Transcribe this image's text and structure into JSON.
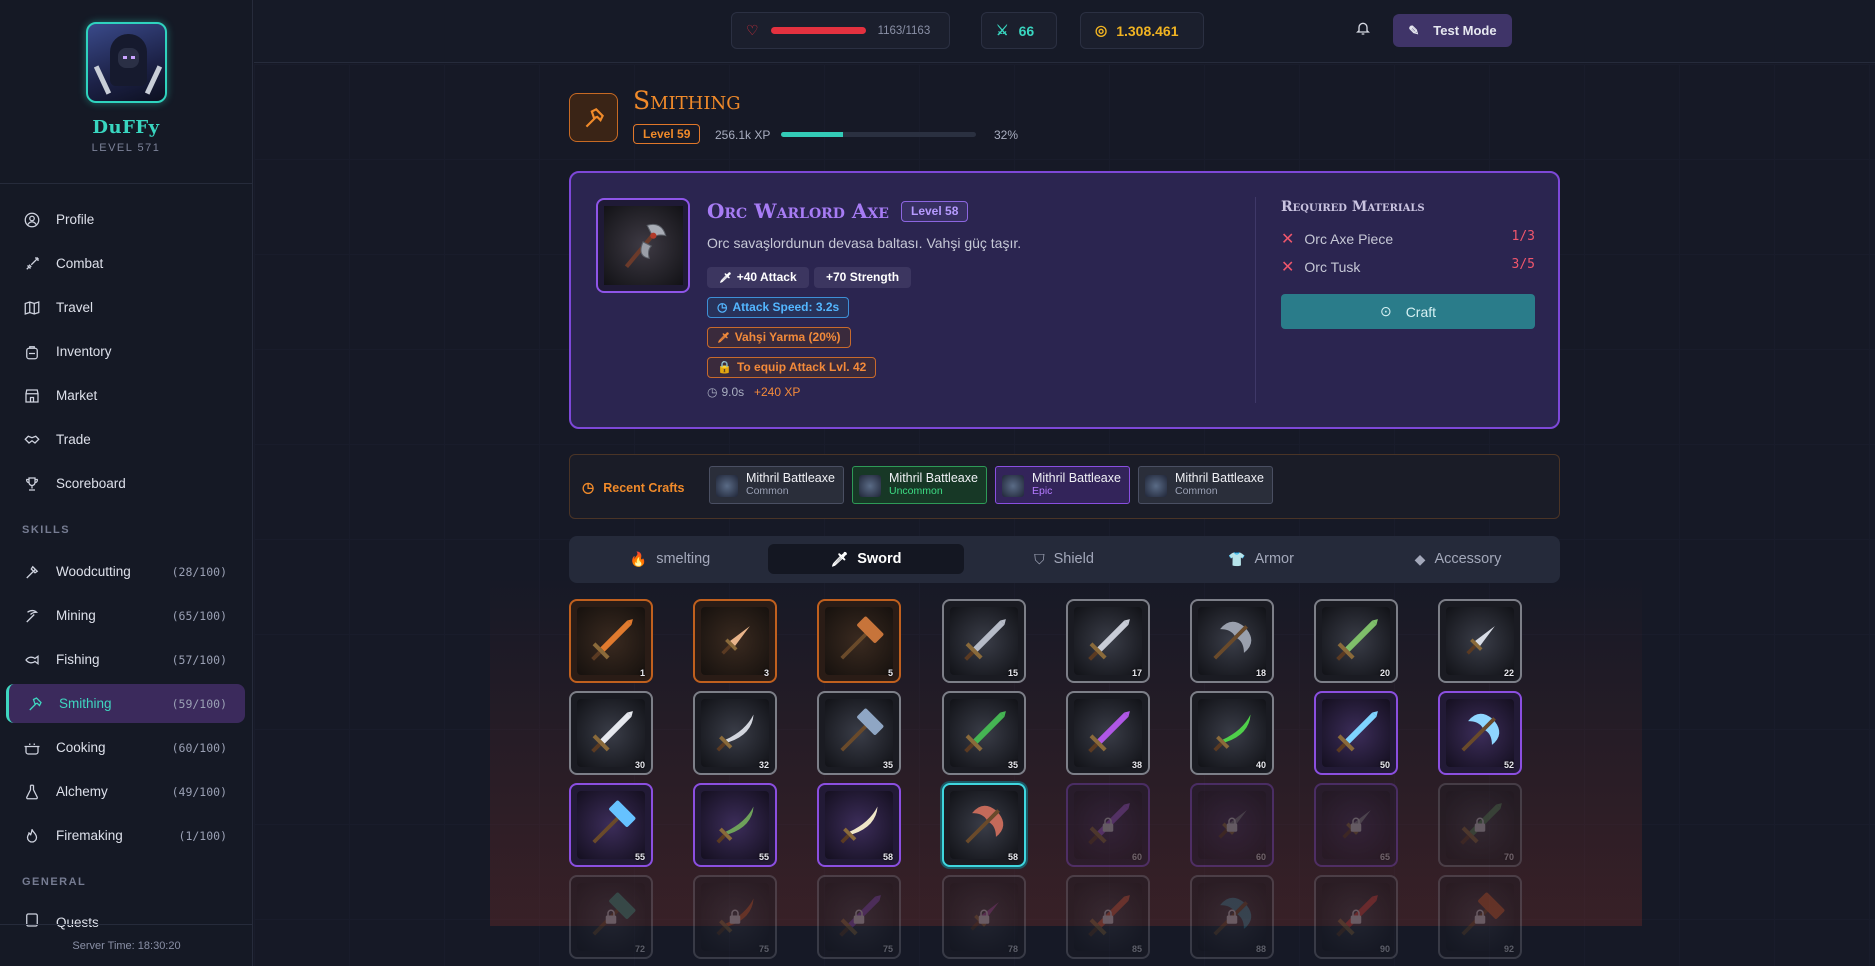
{
  "user": {
    "name": "DuFFy",
    "level": "LEVEL 571"
  },
  "nav": [
    {
      "label": "Profile",
      "icon": "user-circle-icon"
    },
    {
      "label": "Combat",
      "icon": "sword-icon"
    },
    {
      "label": "Travel",
      "icon": "map-icon"
    },
    {
      "label": "Inventory",
      "icon": "backpack-icon"
    },
    {
      "label": "Market",
      "icon": "store-icon"
    },
    {
      "label": "Trade",
      "icon": "handshake-icon"
    },
    {
      "label": "Scoreboard",
      "icon": "trophy-icon"
    }
  ],
  "skills_label": "SKILLS",
  "skills": [
    {
      "label": "Woodcutting",
      "progress": "(28/100)",
      "icon": "axe-icon"
    },
    {
      "label": "Mining",
      "progress": "(65/100)",
      "icon": "pickaxe-icon"
    },
    {
      "label": "Fishing",
      "progress": "(57/100)",
      "icon": "fish-icon"
    },
    {
      "label": "Smithing",
      "progress": "(59/100)",
      "icon": "hammer-icon",
      "active": true
    },
    {
      "label": "Cooking",
      "progress": "(60/100)",
      "icon": "pot-icon"
    },
    {
      "label": "Alchemy",
      "progress": "(49/100)",
      "icon": "flask-icon"
    },
    {
      "label": "Firemaking",
      "progress": "(1/100)",
      "icon": "flame-icon"
    }
  ],
  "general_label": "GENERAL",
  "general": [
    {
      "label": "Quests",
      "icon": "scroll-icon"
    }
  ],
  "server_time": "Server Time: 18:30:20",
  "topbar": {
    "hp": "1163/1163",
    "hp_fraction": 1.0,
    "combat": "66",
    "gold": "1.308.461",
    "mode_label": "Test Mode"
  },
  "page": {
    "title": "Smithing",
    "level": "Level 59",
    "xp": "256.1k XP",
    "xp_fraction": 0.32,
    "xp_percent": "32%"
  },
  "craft": {
    "name": "Orc Warlord Axe",
    "level": "Level 58",
    "description": "Orc savaşlordunun devasa baltası. Vahşi güç taşır.",
    "stats": [
      "+40 Attack",
      "+70 Strength"
    ],
    "attack_speed": "Attack Speed: 3.2s",
    "special": "Vahşi Yarma (20%)",
    "requirement": "To equip Attack Lvl. 42",
    "time": "9.0s",
    "xp_gain": "+240 XP",
    "materials_title": "Required Materials",
    "materials": [
      {
        "name": "Orc Axe Piece",
        "count": "1/3"
      },
      {
        "name": "Orc Tusk",
        "count": "3/5"
      }
    ],
    "button": "Craft"
  },
  "recent": {
    "label": "Recent Crafts",
    "items": [
      {
        "name": "Mithril Battleaxe",
        "rarity": "Common",
        "color": "#9aa0b4"
      },
      {
        "name": "Mithril Battleaxe",
        "rarity": "Uncommon",
        "color": "#3ddc84"
      },
      {
        "name": "Mithril Battleaxe",
        "rarity": "Epic",
        "color": "#b57bff"
      },
      {
        "name": "Mithril Battleaxe",
        "rarity": "Common",
        "color": "#9aa0b4"
      }
    ]
  },
  "tabs": [
    {
      "label": "smelting",
      "icon": "flame-icon"
    },
    {
      "label": "Sword",
      "icon": "sword-icon",
      "active": true
    },
    {
      "label": "Shield",
      "icon": "shield-icon"
    },
    {
      "label": "Armor",
      "icon": "shirt-icon"
    },
    {
      "label": "Accessory",
      "icon": "diamond-icon"
    }
  ],
  "items": [
    {
      "lv": "1",
      "tier": "orange",
      "kind": "sword",
      "color": "#e07a2e"
    },
    {
      "lv": "3",
      "tier": "orange",
      "kind": "dagger",
      "color": "#e8b48a"
    },
    {
      "lv": "5",
      "tier": "orange",
      "kind": "hammer",
      "color": "#c7743a"
    },
    {
      "lv": "15",
      "tier": "common",
      "kind": "sword",
      "color": "#b7bcc8"
    },
    {
      "lv": "17",
      "tier": "common",
      "kind": "sword",
      "color": "#c8ccd6"
    },
    {
      "lv": "18",
      "tier": "common",
      "kind": "axe",
      "color": "#9aa0ad"
    },
    {
      "lv": "20",
      "tier": "common",
      "kind": "sword",
      "color": "#7fbf6a"
    },
    {
      "lv": "22",
      "tier": "common",
      "kind": "dagger",
      "color": "#d9dde6"
    },
    {
      "lv": "30",
      "tier": "common",
      "kind": "sword",
      "color": "#e6e8ee"
    },
    {
      "lv": "32",
      "tier": "common",
      "kind": "scimitar",
      "color": "#d3d6de"
    },
    {
      "lv": "35",
      "tier": "common",
      "kind": "hammer",
      "color": "#8fa6c4"
    },
    {
      "lv": "35",
      "tier": "common",
      "kind": "sword",
      "color": "#45b553"
    },
    {
      "lv": "38",
      "tier": "common",
      "kind": "sword",
      "color": "#b057e6"
    },
    {
      "lv": "40",
      "tier": "common",
      "kind": "scimitar",
      "color": "#4fd04a"
    },
    {
      "lv": "50",
      "tier": "purple",
      "kind": "sword",
      "color": "#7fd4ff"
    },
    {
      "lv": "52",
      "tier": "purple",
      "kind": "axe",
      "color": "#8fd6ff"
    },
    {
      "lv": "55",
      "tier": "purple",
      "kind": "hammer",
      "color": "#66c2ff"
    },
    {
      "lv": "55",
      "tier": "purple",
      "kind": "scimitar",
      "color": "#6ea15a"
    },
    {
      "lv": "58",
      "tier": "purple",
      "kind": "scimitar",
      "color": "#efe6c8"
    },
    {
      "lv": "58",
      "tier": "selected",
      "kind": "axe",
      "color": "#c46a5a"
    },
    {
      "lv": "60",
      "tier": "purple",
      "kind": "sword",
      "color": "#a05ae0",
      "locked": true
    },
    {
      "lv": "60",
      "tier": "purple",
      "kind": "dagger",
      "color": "#7a7f8c",
      "locked": true
    },
    {
      "lv": "65",
      "tier": "purple",
      "kind": "dagger",
      "color": "#8a8f9c",
      "locked": true
    },
    {
      "lv": "70",
      "tier": "common",
      "kind": "sword",
      "color": "#4f8a5a",
      "locked": true
    },
    {
      "lv": "72",
      "tier": "common",
      "kind": "hammer",
      "color": "#3a9a8a",
      "locked": true
    },
    {
      "lv": "75",
      "tier": "common",
      "kind": "scimitar",
      "color": "#c45a2a",
      "locked": true
    },
    {
      "lv": "75",
      "tier": "common",
      "kind": "sword",
      "color": "#7a4ac0",
      "locked": true
    },
    {
      "lv": "78",
      "tier": "common",
      "kind": "dagger",
      "color": "#9a4aa0",
      "locked": true
    },
    {
      "lv": "85",
      "tier": "common",
      "kind": "sword",
      "color": "#d05a3a",
      "locked": true
    },
    {
      "lv": "88",
      "tier": "common",
      "kind": "axe",
      "color": "#3a8aa0",
      "locked": true
    },
    {
      "lv": "90",
      "tier": "common",
      "kind": "sword",
      "color": "#d0403a",
      "locked": true
    },
    {
      "lv": "92",
      "tier": "common",
      "kind": "hammer",
      "color": "#c05a2a",
      "locked": true
    }
  ]
}
